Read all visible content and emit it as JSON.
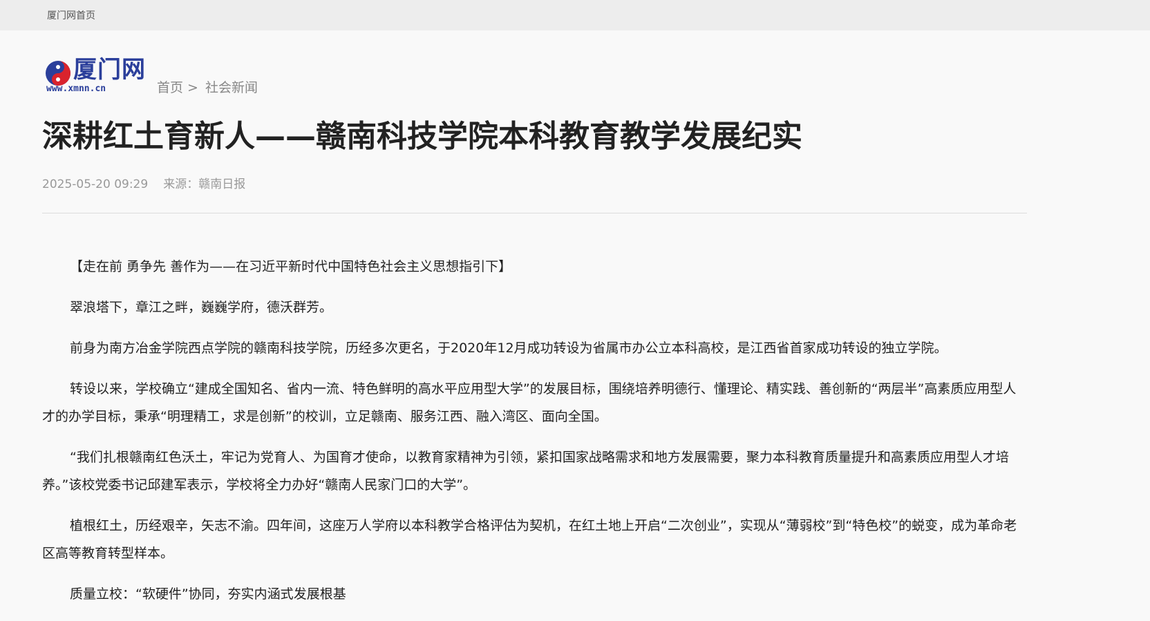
{
  "topbar": {
    "home_link": "厦门网首页"
  },
  "logo": {
    "name": "厦门网",
    "url": "www.xmnn.cn",
    "colors": {
      "red": "#d9232d",
      "blue": "#2b3f9b"
    }
  },
  "breadcrumb": {
    "home": "首页",
    "separator": ">",
    "section": "社会新闻"
  },
  "article": {
    "title": "深耕红土育新人——赣南科技学院本科教育教学发展纪实",
    "datetime": "2025-05-20 09:29",
    "source_label": "来源：",
    "source": "赣南日报",
    "paragraphs": [
      "【走在前 勇争先 善作为——在习近平新时代中国特色社会主义思想指引下】",
      "翠浪塔下，章江之畔，巍巍学府，德沃群芳。",
      "前身为南方冶金学院西点学院的赣南科技学院，历经多次更名，于2020年12月成功转设为省属市办公立本科高校，是江西省首家成功转设的独立学院。",
      "转设以来，学校确立“建成全国知名、省内一流、特色鲜明的高水平应用型大学”的发展目标，围绕培养明德行、懂理论、精实践、善创新的“两层半”高素质应用型人才的办学目标，秉承“明理精工，求是创新”的校训，立足赣南、服务江西、融入湾区、面向全国。",
      "“我们扎根赣南红色沃土，牢记为党育人、为国育才使命，以教育家精神为引领，紧扣国家战略需求和地方发展需要，聚力本科教育质量提升和高素质应用型人才培养。”该校党委书记邱建军表示，学校将全力办好“赣南人民家门口的大学”。",
      "植根红土，历经艰辛，矢志不渝。四年间，这座万人学府以本科教学合格评估为契机，在红土地上开启“二次创业”，实现从“薄弱校”到“特色校”的蜕变，成为革命老区高等教育转型样本。",
      "质量立校：“软硬件”协同，夯实内涵式发展根基"
    ]
  }
}
